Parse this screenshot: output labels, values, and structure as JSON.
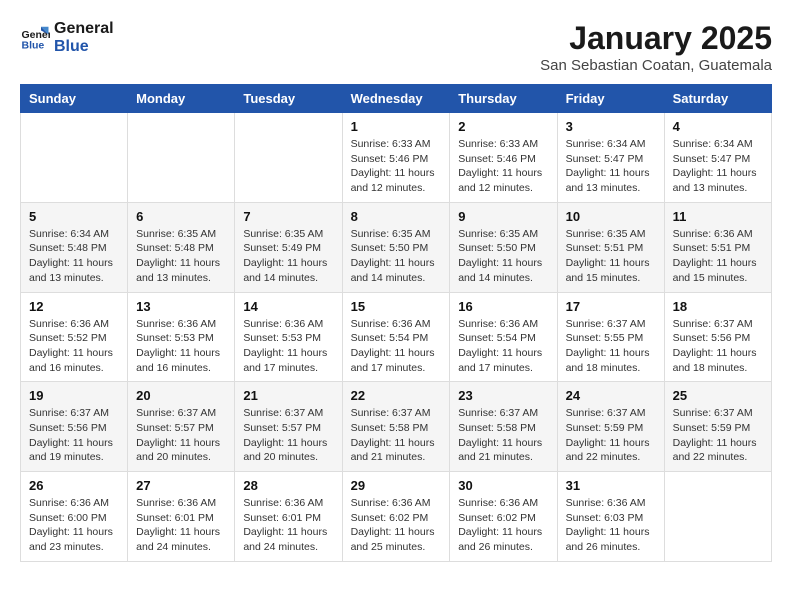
{
  "header": {
    "logo_line1": "General",
    "logo_line2": "Blue",
    "month": "January 2025",
    "location": "San Sebastian Coatan, Guatemala"
  },
  "days_of_week": [
    "Sunday",
    "Monday",
    "Tuesday",
    "Wednesday",
    "Thursday",
    "Friday",
    "Saturday"
  ],
  "weeks": [
    [
      {
        "day": "",
        "info": ""
      },
      {
        "day": "",
        "info": ""
      },
      {
        "day": "",
        "info": ""
      },
      {
        "day": "1",
        "info": "Sunrise: 6:33 AM\nSunset: 5:46 PM\nDaylight: 11 hours\nand 12 minutes."
      },
      {
        "day": "2",
        "info": "Sunrise: 6:33 AM\nSunset: 5:46 PM\nDaylight: 11 hours\nand 12 minutes."
      },
      {
        "day": "3",
        "info": "Sunrise: 6:34 AM\nSunset: 5:47 PM\nDaylight: 11 hours\nand 13 minutes."
      },
      {
        "day": "4",
        "info": "Sunrise: 6:34 AM\nSunset: 5:47 PM\nDaylight: 11 hours\nand 13 minutes."
      }
    ],
    [
      {
        "day": "5",
        "info": "Sunrise: 6:34 AM\nSunset: 5:48 PM\nDaylight: 11 hours\nand 13 minutes."
      },
      {
        "day": "6",
        "info": "Sunrise: 6:35 AM\nSunset: 5:48 PM\nDaylight: 11 hours\nand 13 minutes."
      },
      {
        "day": "7",
        "info": "Sunrise: 6:35 AM\nSunset: 5:49 PM\nDaylight: 11 hours\nand 14 minutes."
      },
      {
        "day": "8",
        "info": "Sunrise: 6:35 AM\nSunset: 5:50 PM\nDaylight: 11 hours\nand 14 minutes."
      },
      {
        "day": "9",
        "info": "Sunrise: 6:35 AM\nSunset: 5:50 PM\nDaylight: 11 hours\nand 14 minutes."
      },
      {
        "day": "10",
        "info": "Sunrise: 6:35 AM\nSunset: 5:51 PM\nDaylight: 11 hours\nand 15 minutes."
      },
      {
        "day": "11",
        "info": "Sunrise: 6:36 AM\nSunset: 5:51 PM\nDaylight: 11 hours\nand 15 minutes."
      }
    ],
    [
      {
        "day": "12",
        "info": "Sunrise: 6:36 AM\nSunset: 5:52 PM\nDaylight: 11 hours\nand 16 minutes."
      },
      {
        "day": "13",
        "info": "Sunrise: 6:36 AM\nSunset: 5:53 PM\nDaylight: 11 hours\nand 16 minutes."
      },
      {
        "day": "14",
        "info": "Sunrise: 6:36 AM\nSunset: 5:53 PM\nDaylight: 11 hours\nand 17 minutes."
      },
      {
        "day": "15",
        "info": "Sunrise: 6:36 AM\nSunset: 5:54 PM\nDaylight: 11 hours\nand 17 minutes."
      },
      {
        "day": "16",
        "info": "Sunrise: 6:36 AM\nSunset: 5:54 PM\nDaylight: 11 hours\nand 17 minutes."
      },
      {
        "day": "17",
        "info": "Sunrise: 6:37 AM\nSunset: 5:55 PM\nDaylight: 11 hours\nand 18 minutes."
      },
      {
        "day": "18",
        "info": "Sunrise: 6:37 AM\nSunset: 5:56 PM\nDaylight: 11 hours\nand 18 minutes."
      }
    ],
    [
      {
        "day": "19",
        "info": "Sunrise: 6:37 AM\nSunset: 5:56 PM\nDaylight: 11 hours\nand 19 minutes."
      },
      {
        "day": "20",
        "info": "Sunrise: 6:37 AM\nSunset: 5:57 PM\nDaylight: 11 hours\nand 20 minutes."
      },
      {
        "day": "21",
        "info": "Sunrise: 6:37 AM\nSunset: 5:57 PM\nDaylight: 11 hours\nand 20 minutes."
      },
      {
        "day": "22",
        "info": "Sunrise: 6:37 AM\nSunset: 5:58 PM\nDaylight: 11 hours\nand 21 minutes."
      },
      {
        "day": "23",
        "info": "Sunrise: 6:37 AM\nSunset: 5:58 PM\nDaylight: 11 hours\nand 21 minutes."
      },
      {
        "day": "24",
        "info": "Sunrise: 6:37 AM\nSunset: 5:59 PM\nDaylight: 11 hours\nand 22 minutes."
      },
      {
        "day": "25",
        "info": "Sunrise: 6:37 AM\nSunset: 5:59 PM\nDaylight: 11 hours\nand 22 minutes."
      }
    ],
    [
      {
        "day": "26",
        "info": "Sunrise: 6:36 AM\nSunset: 6:00 PM\nDaylight: 11 hours\nand 23 minutes."
      },
      {
        "day": "27",
        "info": "Sunrise: 6:36 AM\nSunset: 6:01 PM\nDaylight: 11 hours\nand 24 minutes."
      },
      {
        "day": "28",
        "info": "Sunrise: 6:36 AM\nSunset: 6:01 PM\nDaylight: 11 hours\nand 24 minutes."
      },
      {
        "day": "29",
        "info": "Sunrise: 6:36 AM\nSunset: 6:02 PM\nDaylight: 11 hours\nand 25 minutes."
      },
      {
        "day": "30",
        "info": "Sunrise: 6:36 AM\nSunset: 6:02 PM\nDaylight: 11 hours\nand 26 minutes."
      },
      {
        "day": "31",
        "info": "Sunrise: 6:36 AM\nSunset: 6:03 PM\nDaylight: 11 hours\nand 26 minutes."
      },
      {
        "day": "",
        "info": ""
      }
    ]
  ]
}
